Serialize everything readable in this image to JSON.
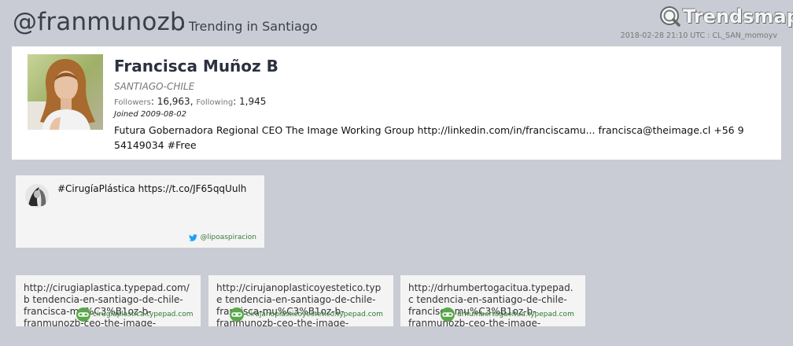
{
  "header": {
    "handle": "@franmunozb",
    "trending": "- Trending in Santiago",
    "logo_text": "Trendsmap",
    "meta": "2018-02-28 21:10 UTC : CL_SAN_momoyv"
  },
  "profile": {
    "name": "Francisca Muñoz B",
    "location": "SANTIAGO-CHILE",
    "followers_label": "Followers",
    "followers": "16,963",
    "following_label": "Following",
    "following": "1,945",
    "joined": "Joined 2009-08-02",
    "bio": "Futura Gobernadora Regional CEO The Image Working Group http://linkedin.com/in/franciscamu... francisca@theimage.cl +56 9 54149034 #Free"
  },
  "tweet": {
    "text": "#CirugíaPlástica https://t.co/JF65qqUulh",
    "source": "@lipoaspiracion",
    "icon": "twitter-bird-icon"
  },
  "links": [
    {
      "text": "http://cirugiaplastica.typepad.com/b tendencia-en-santiago-de-chile-francisca-mu%C3%B1oz-b-franmunozb-ceo-the-image-",
      "source": "cirugiaplastica.typepad.com"
    },
    {
      "text": "http://cirujanoplasticoyestetico.type tendencia-en-santiago-de-chile-francisca-mu%C3%B1oz-b-franmunozb-ceo-the-image-",
      "source": "cirujanoplasticoyestetico.typepad.com"
    },
    {
      "text": "http://drhumbertogacitua.typepad.c tendencia-en-santiago-de-chile-francisca-mu%C3%B1oz-b-franmunozb-ceo-the-image-",
      "source": "drhumbertogacitua.typepad.com"
    }
  ],
  "colors": {
    "background": "#c9ccd4",
    "card": "#ffffff",
    "link_green": "#2e7a2e"
  }
}
